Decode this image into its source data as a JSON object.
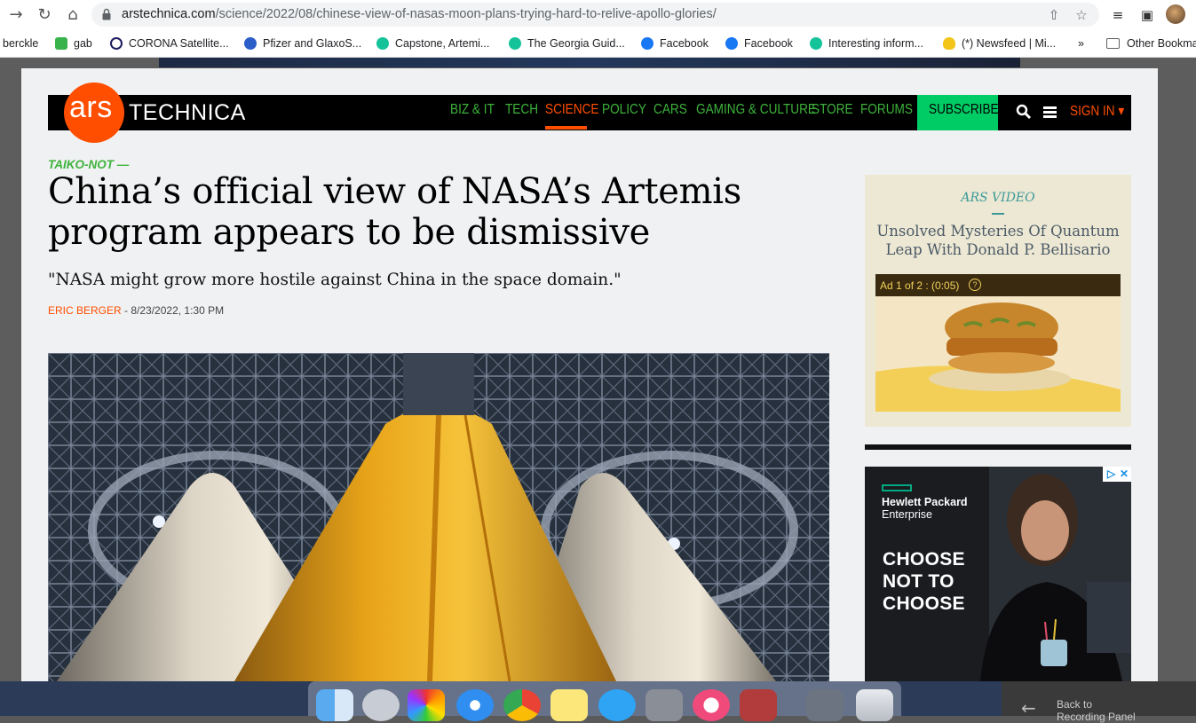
{
  "browser": {
    "url_host": "arstechnica.com",
    "url_path": "/science/2022/08/chinese-view-of-nasas-moon-plans-trying-hard-to-relive-apollo-glories/"
  },
  "bookmarks": [
    {
      "label": "berckle",
      "icon": "none"
    },
    {
      "label": "gab",
      "icon": "gab-icon"
    },
    {
      "label": "CORONA Satellite...",
      "icon": "corona-icon"
    },
    {
      "label": "Pfizer and GlaxoS...",
      "icon": "pfizer-icon"
    },
    {
      "label": "Capstone, Artemi...",
      "icon": "teal-circle-icon"
    },
    {
      "label": "The Georgia Guid...",
      "icon": "teal-circle-icon"
    },
    {
      "label": "Facebook",
      "icon": "facebook-icon"
    },
    {
      "label": "Facebook",
      "icon": "facebook-icon"
    },
    {
      "label": "Interesting inform...",
      "icon": "teal-circle-icon"
    },
    {
      "label": "(*) Newsfeed | Mi...",
      "icon": "lightbulb-icon"
    },
    {
      "label": "»",
      "icon": "none"
    },
    {
      "label": "Other Bookma",
      "icon": "folder-icon"
    }
  ],
  "site": {
    "logo_ars": "ars",
    "logo_technica": "TECHNICA",
    "nav": [
      "BIZ & IT",
      "TECH",
      "SCIENCE",
      "POLICY",
      "CARS",
      "GAMING & CULTURE",
      "STORE",
      "FORUMS"
    ],
    "active_nav": "SCIENCE",
    "subscribe": "SUBSCRIBE",
    "signin": "SIGN IN",
    "colors": {
      "brand": "#ff4e00",
      "nav_green": "#3db33b",
      "subscribe_green": "#00cc66"
    }
  },
  "article": {
    "kicker": "TAIKO-NOT —",
    "headline": "China’s official view of NASA’s Artemis program appears to be dismissive",
    "dek": "\"NASA might grow more hostile against China in the space domain.\"",
    "author": "ERIC BERGER",
    "byline_sep": " - ",
    "date": "8/23/2022, 1:30 PM"
  },
  "sidebar": {
    "video_label": "ARS VIDEO",
    "video_title": "Unsolved Mysteries Of Quantum Leap With Donald P. Bellisario",
    "ad_counter": "Ad 1 of 2 : (0:05)",
    "ad_help": "?"
  },
  "hpe_ad": {
    "brand_line1": "Hewlett Packard",
    "brand_line2": "Enterprise",
    "cta_line1": "CHOOSE",
    "cta_line2": "NOT TO",
    "cta_line3": "CHOOSE",
    "adchoices": "▷",
    "close": "✕"
  },
  "dock": {
    "back_line1": "Back to",
    "back_line2": "Recording Panel"
  }
}
